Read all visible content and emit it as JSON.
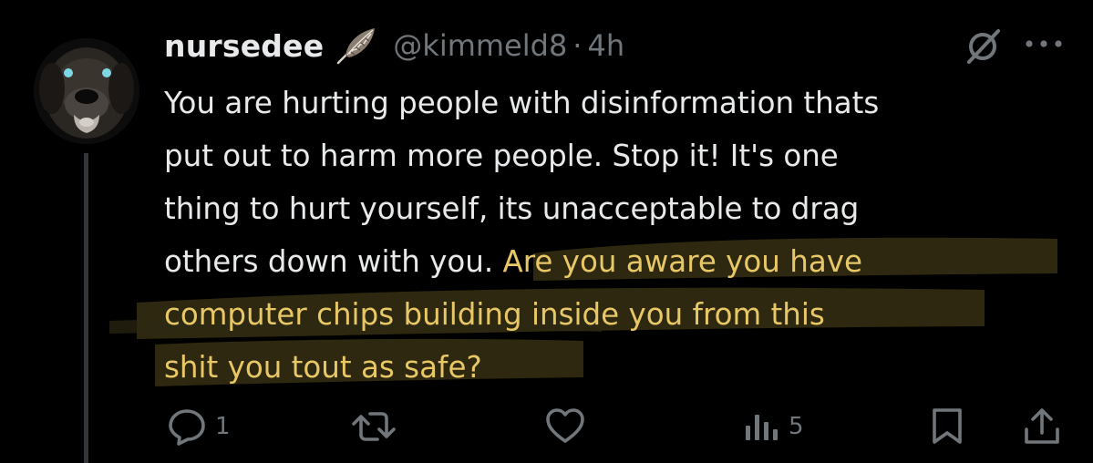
{
  "tweet": {
    "display_name": "nursedee",
    "handle": "@kimmeld8",
    "separator": "·",
    "time": "4h",
    "lines": [
      {
        "plain": "You are hurting people with disinformation thats",
        "highlight": ""
      },
      {
        "plain": "put out to harm more people. Stop it! It's one",
        "highlight": ""
      },
      {
        "plain": "thing to hurt yourself, its unacceptable to drag",
        "highlight": ""
      },
      {
        "plain": "others down with you. ",
        "highlight": "Are you aware you have"
      },
      {
        "plain": "",
        "highlight": "computer chips building  inside you from this"
      },
      {
        "plain": "",
        "highlight": "shit you tout as safe?"
      }
    ]
  },
  "colors": {
    "background": "#000000",
    "text": "#e7e9ea",
    "secondary": "#71767b",
    "highlight_text": "#e8c766",
    "highlight_marker": "#6b5a1f"
  },
  "icons": {
    "avatar": "dog-avatar",
    "badge": "feather-icon",
    "grok": "grok-icon",
    "more": "more-icon",
    "reply": "reply-icon",
    "retweet": "retweet-icon",
    "like": "like-icon",
    "views": "views-icon",
    "bookmark": "bookmark-icon",
    "share": "share-icon"
  },
  "actions": {
    "reply_count": "1",
    "retweet_count": "",
    "like_count": "",
    "views_count": "5"
  }
}
